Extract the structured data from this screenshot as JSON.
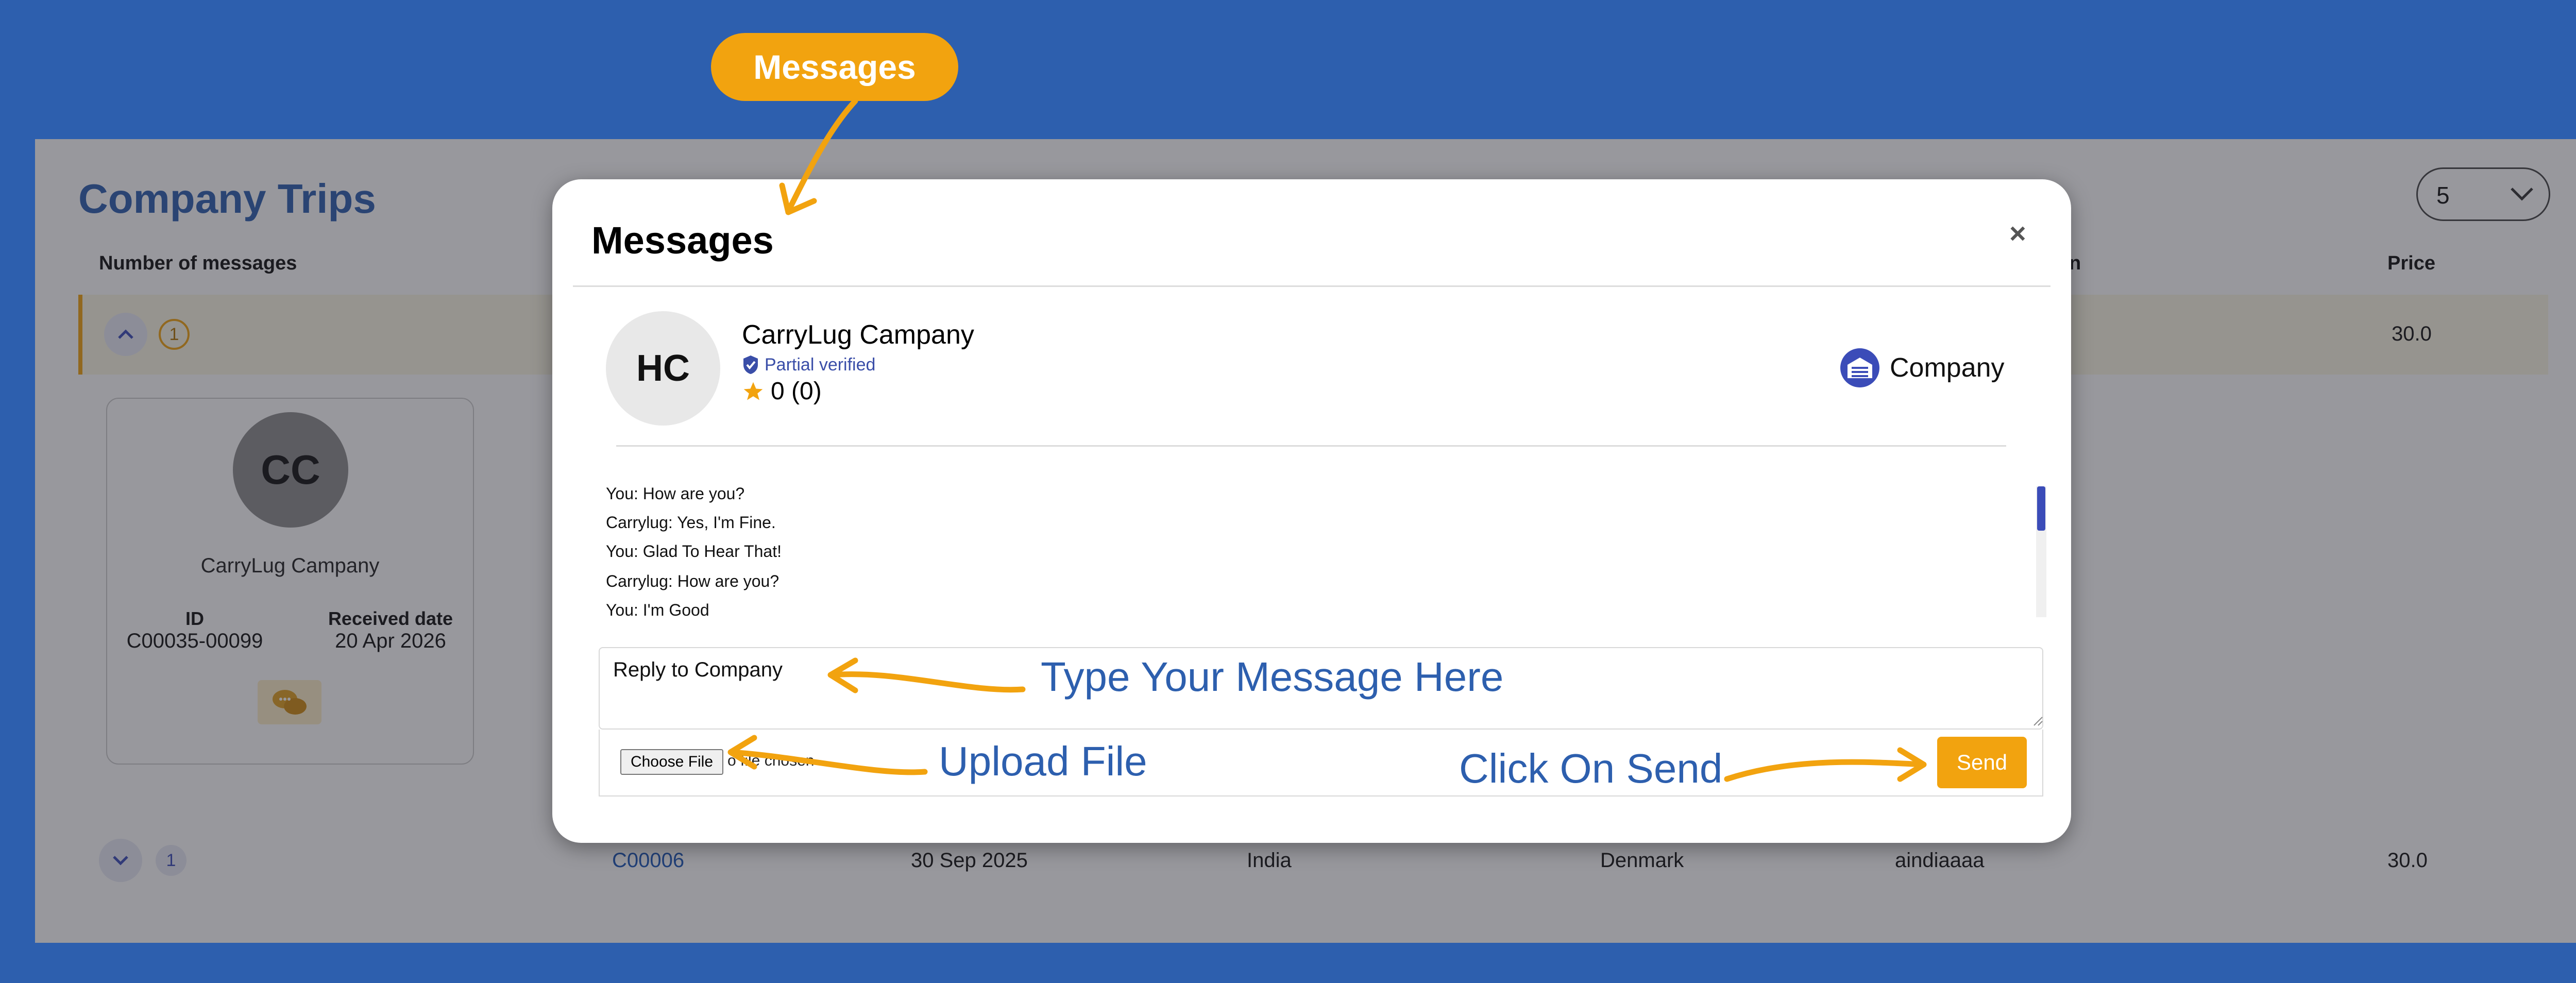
{
  "page": {
    "title": "Company Trips",
    "page_size": "5",
    "columns": {
      "number_of_messages": "Number of messages",
      "destination_partial": "n",
      "price": "Price"
    },
    "rows": [
      {
        "count": "1",
        "price": "30.0"
      },
      {
        "count": "1",
        "id": "C00006",
        "date": "30 Sep 2025",
        "from": "India",
        "to": "Denmark",
        "company": "aindiaaaa",
        "price": "30.0"
      }
    ],
    "card": {
      "initials": "CC",
      "name": "CarryLug Campany",
      "id_label": "ID",
      "id_value": "C00035-00099",
      "date_label": "Received date",
      "date_value": "20 Apr 2026"
    }
  },
  "modal": {
    "title": "Messages",
    "close": "×",
    "header": {
      "initials": "HC",
      "name": "CarryLug Campany",
      "verified": "Partial verified",
      "rating": "0 (0)",
      "type": "Company"
    },
    "messages": [
      {
        "sender": "You:",
        "text": "How are you?"
      },
      {
        "sender": "Carrylug:",
        "text": "Yes, I'm Fine."
      },
      {
        "sender": "You:",
        "text": "Glad To Hear That!"
      },
      {
        "sender": "Carrylug:",
        "text": "How are you?"
      },
      {
        "sender": "You:",
        "text": "I'm Good"
      }
    ],
    "reply_placeholder": "Reply to Company",
    "choose_file": "Choose File",
    "file_status": "o file chosen",
    "send": "Send"
  },
  "annotations": {
    "pill": "Messages",
    "type_message": "Type Your Message Here",
    "upload_file": "Upload File",
    "click_send": "Click On Send"
  },
  "colors": {
    "background": "#2d5fae",
    "accent": "#f2a30f",
    "verified": "#3a4ea8",
    "annotation_text": "#2d5fae"
  }
}
